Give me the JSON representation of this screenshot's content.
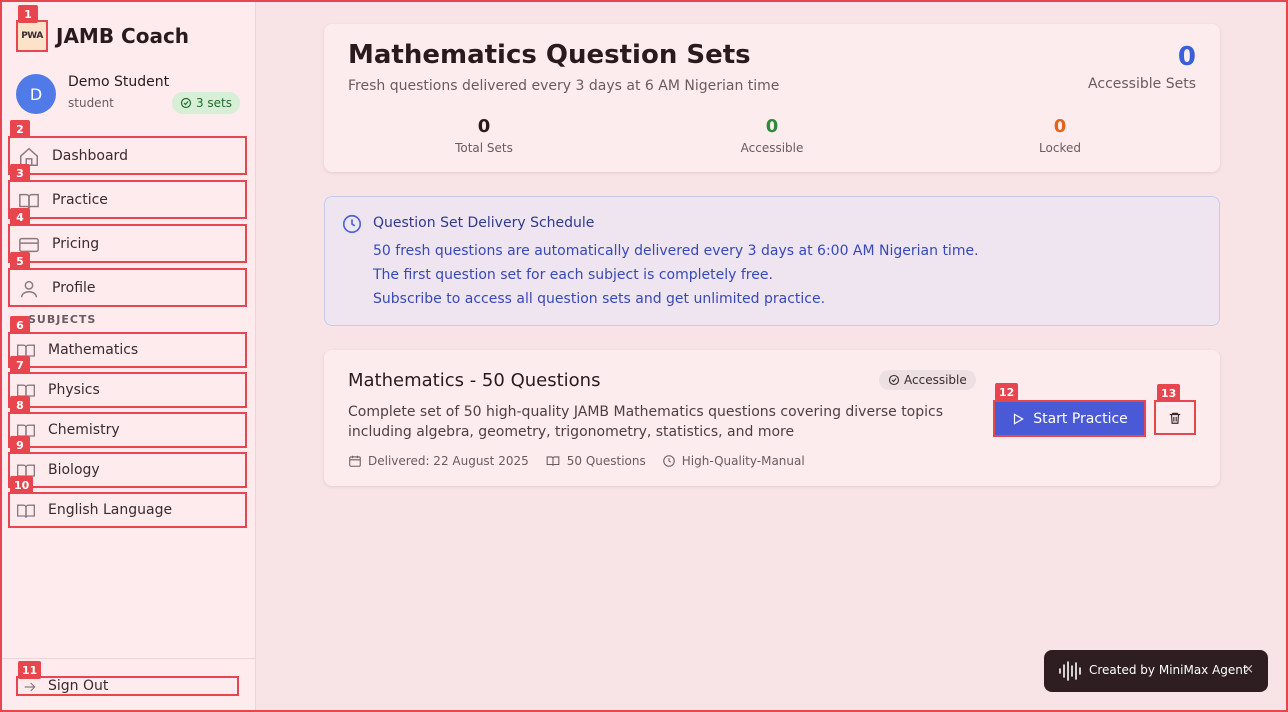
{
  "brand": {
    "name": "JAMB Coach",
    "logo_text": "PWA"
  },
  "user": {
    "initial": "D",
    "name": "Demo Student",
    "role": "student",
    "sets_badge": "3 sets"
  },
  "nav": [
    {
      "label": "Dashboard",
      "icon": "home-icon"
    },
    {
      "label": "Practice",
      "icon": "book-icon"
    },
    {
      "label": "Pricing",
      "icon": "credit-card-icon"
    },
    {
      "label": "Profile",
      "icon": "user-icon"
    }
  ],
  "subjects_label": "SUBJECTS",
  "subjects": [
    {
      "label": "Mathematics"
    },
    {
      "label": "Physics"
    },
    {
      "label": "Chemistry"
    },
    {
      "label": "Biology"
    },
    {
      "label": "English Language"
    }
  ],
  "signout_label": "Sign Out",
  "markers": [
    "1",
    "2",
    "3",
    "4",
    "5",
    "6",
    "7",
    "8",
    "9",
    "10",
    "11",
    "12",
    "13"
  ],
  "header": {
    "title": "Mathematics Question Sets",
    "subtitle": "Fresh questions delivered every 3 days at 6 AM Nigerian time",
    "accessible_count": "0",
    "accessible_label": "Accessible Sets",
    "stats": [
      {
        "value": "0",
        "label": "Total Sets",
        "color": "#2a1a1e"
      },
      {
        "value": "0",
        "label": "Accessible",
        "color": "#2e8a3a"
      },
      {
        "value": "0",
        "label": "Locked",
        "color": "#e0641c"
      }
    ]
  },
  "info": {
    "title": "Question Set Delivery Schedule",
    "lines": [
      "50 fresh questions are automatically delivered every 3 days at 6:00 AM Nigerian time.",
      "The first question set for each subject is completely free.",
      "Subscribe to access all question sets and get unlimited practice."
    ]
  },
  "question_set": {
    "title": "Mathematics - 50 Questions",
    "badge": "Accessible",
    "description": "Complete set of 50 high-quality JAMB Mathematics questions covering diverse topics including algebra, geometry, trigonometry, statistics, and more",
    "delivered": "Delivered: 22 August 2025",
    "count": "50 Questions",
    "quality": "High-Quality-Manual",
    "start_label": "Start Practice"
  },
  "toast": {
    "text": "Created by MiniMax Agent",
    "close": "×"
  },
  "colors": {
    "accent": "#e8464e",
    "primary": "#4a5ad6",
    "sidebar_bg": "#fdebed",
    "page_bg": "#f8e4e6"
  }
}
